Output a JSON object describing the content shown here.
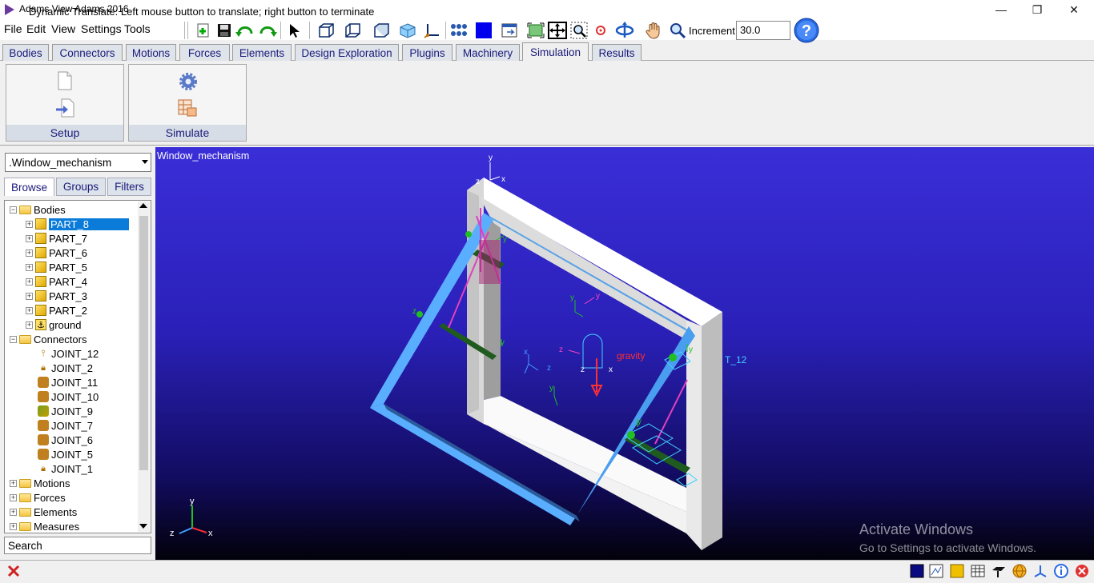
{
  "window": {
    "title": "Adams View Adams 2016",
    "minimize": "—",
    "maximize": "❐",
    "close": "✕"
  },
  "menu": [
    "File",
    "Edit",
    "View",
    "Settings",
    "Tools"
  ],
  "toolbar": {
    "increment_label": "Increment",
    "increment_value": "30.0"
  },
  "ribbon_tabs": [
    "Bodies",
    "Connectors",
    "Motions",
    "Forces",
    "Elements",
    "Design Exploration",
    "Plugins",
    "Machinery",
    "Simulation",
    "Results"
  ],
  "active_tab": "Simulation",
  "ribbon_groups": [
    {
      "label": "Setup"
    },
    {
      "label": "Simulate"
    }
  ],
  "model_selector": {
    "value": ".Window_mechanism"
  },
  "browser_tabs": [
    "Browse",
    "Groups",
    "Filters"
  ],
  "tree": {
    "bodies": {
      "label": "Bodies",
      "items": [
        "PART_8",
        "PART_7",
        "PART_6",
        "PART_5",
        "PART_4",
        "PART_3",
        "PART_2",
        "ground"
      ]
    },
    "connectors": {
      "label": "Connectors",
      "items": [
        "JOINT_12",
        "JOINT_2",
        "JOINT_11",
        "JOINT_10",
        "JOINT_9",
        "JOINT_7",
        "JOINT_6",
        "JOINT_5",
        "JOINT_1"
      ]
    },
    "other": [
      "Motions",
      "Forces",
      "Elements",
      "Measures"
    ]
  },
  "search": {
    "value": "Search"
  },
  "viewport": {
    "title": "Window_mechanism",
    "labels": {
      "gravity": "gravity",
      "joint_tag": "T_12",
      "axis_y": "y",
      "axis_z": "z",
      "axis_x": "x"
    }
  },
  "status": {
    "text": "Dynamic Translate: Left mouse button to translate; right button to terminate"
  },
  "watermark": {
    "line1": "Activate Windows",
    "line2": "Go to Settings to activate Windows."
  },
  "colors": {
    "accent": "#1a1a7a",
    "selection": "#0a7bd8",
    "frame": "#f2f2f2",
    "sash": "#5aaeff"
  }
}
